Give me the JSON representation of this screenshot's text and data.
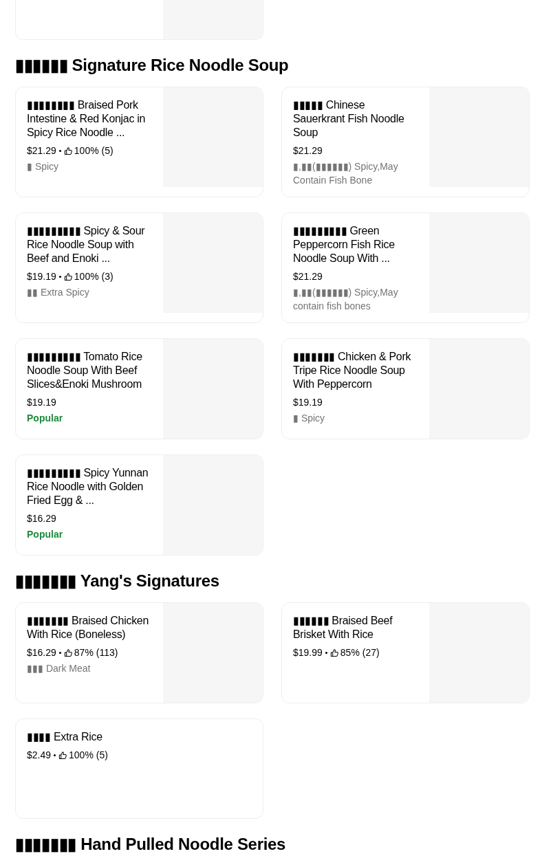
{
  "top_card": {
    "image": true
  },
  "sections": [
    {
      "title": "▮▮▮▮▮▮ Signature Rice Noodle Soup",
      "items": [
        {
          "name": "▮▮▮▮▮▮▮▮ Braised Pork Intestine & Red Konjac in Spicy Rice Noodle ...",
          "price": "$21.29",
          "rating": "100% (5)",
          "note": {
            "text": "▮ Spicy",
            "kind": "tag"
          },
          "image": true
        },
        {
          "name": "▮▮▮▮▮ Chinese Sauerkrant Fish Noodle Soup",
          "price": "$21.29",
          "note": {
            "text": "▮,▮▮(▮▮▮▮▮▮) Spicy,May Contain Fish Bone",
            "kind": "tag"
          },
          "image": true
        },
        {
          "name": "▮▮▮▮▮▮▮▮▮ Spicy & Sour Rice Noodle Soup with Beef and Enoki ...",
          "price": "$19.19",
          "rating": "100% (3)",
          "note": {
            "text": "▮▮ Extra Spicy",
            "kind": "tag"
          },
          "image": true
        },
        {
          "name": "▮▮▮▮▮▮▮▮▮ Green Peppercorn Fish Rice Noodle Soup With ...",
          "price": "$21.29",
          "note": {
            "text": "▮,▮▮(▮▮▮▮▮▮) Spicy,May contain fish bones",
            "kind": "tag"
          },
          "image": true
        },
        {
          "name": "▮▮▮▮▮▮▮▮▮ Tomato Rice Noodle Soup With Beef Slices&Enoki Mushroom",
          "price": "$19.19",
          "note": {
            "text": "Popular",
            "kind": "popular"
          },
          "image": true
        },
        {
          "name": "▮▮▮▮▮▮▮ Chicken & Pork Tripe Rice Noodle Soup With Peppercorn",
          "price": "$19.19",
          "note": {
            "text": "▮ Spicy",
            "kind": "tag"
          },
          "image": true
        },
        {
          "name": "▮▮▮▮▮▮▮▮▮ Spicy Yunnan Rice Noodle with Golden Fried Egg & ...",
          "price": "$16.29",
          "note": {
            "text": "Popular",
            "kind": "popular"
          },
          "image": true
        }
      ]
    },
    {
      "title": "▮▮▮▮▮▮▮ Yang's Signatures",
      "items": [
        {
          "name": "▮▮▮▮▮▮▮ Braised Chicken With Rice (Boneless)",
          "price": "$16.29",
          "rating": "87% (113)",
          "note": {
            "text": "▮▮▮ Dark Meat",
            "kind": "tag"
          },
          "image": true
        },
        {
          "name": "▮▮▮▮▮▮ Braised Beef Brisket With Rice",
          "price": "$19.99",
          "rating": "85% (27)",
          "image": true
        },
        {
          "name": "▮▮▮▮ Extra Rice",
          "price": "$2.49",
          "rating": "100% (5)",
          "image": false
        }
      ]
    },
    {
      "title": "▮▮▮▮▮▮▮ Hand Pulled Noodle Series"
    }
  ]
}
